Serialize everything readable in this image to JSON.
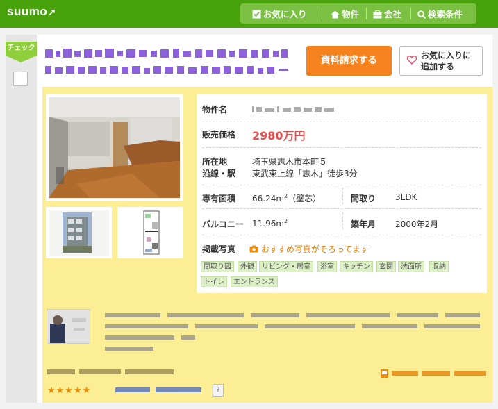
{
  "header": {
    "logo": "suumo",
    "nav": [
      {
        "label": "お気に入り",
        "icon": "checkbox-icon"
      },
      {
        "label": "物件",
        "icon": "home-icon"
      },
      {
        "label": "会社",
        "icon": "building-icon"
      },
      {
        "label": "検索条件",
        "icon": "search-icon"
      }
    ]
  },
  "sidebar": {
    "check_label": "チェック"
  },
  "actions": {
    "request_label": "資料請求する",
    "favorite_label_line1": "お気に入りに",
    "favorite_label_line2": "追加する"
  },
  "property": {
    "name_label": "物件名",
    "price_label": "販売価格",
    "price": "2980万円",
    "location_label": "所在地",
    "location": "埼玉県志木市本町５",
    "line_label": "沿線・駅",
    "line": "東武東上線「志木」徒歩3分",
    "area_label": "専有面積",
    "area": "66.24m",
    "area_sup": "2",
    "area_note": "（壁芯）",
    "layout_label": "間取り",
    "layout": "3LDK",
    "balcony_label": "バルコニー",
    "balcony": "11.96m",
    "balcony_sup": "2",
    "built_label": "築年月",
    "built": "2000年2月",
    "photos_label": "掲載写真",
    "photos_note": "おすすめ写真がそろってます",
    "photo_tags": [
      "間取り図",
      "外観",
      "リビング・居室",
      "浴室",
      "キッチン",
      "玄関",
      "洗面所",
      "収納",
      "トイレ",
      "エントランス"
    ]
  },
  "colors": {
    "header_green": "#47a20c",
    "nav_green": "#7ac143",
    "panel_yellow": "#fbee95",
    "price_red": "#e94b4b",
    "request_orange": "#f7831f",
    "title_purple": "#6a33c9"
  }
}
